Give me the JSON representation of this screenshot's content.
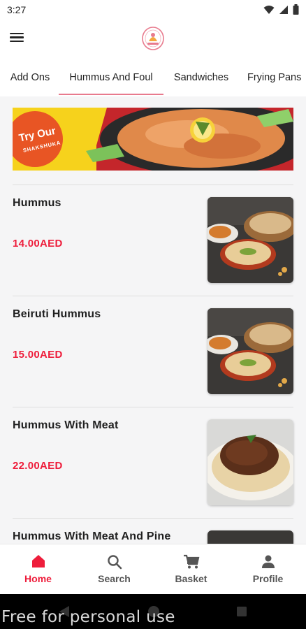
{
  "status_bar": {
    "time": "3:27"
  },
  "header": {
    "logo_icon": "restaurant-logo-icon",
    "menu_icon": "hamburger-menu-icon"
  },
  "tabs": [
    {
      "label": "Add Ons"
    },
    {
      "label": "Hummus And Foul",
      "active": true
    },
    {
      "label": "Sandwiches"
    },
    {
      "label": "Frying Pans"
    }
  ],
  "banner": {
    "headline": "Try Our",
    "subline": "SHAKSHUKA"
  },
  "items": [
    {
      "name": "Hummus",
      "price": "14.00AED",
      "image": "hummus-plate"
    },
    {
      "name": "Beiruti Hummus",
      "price": "15.00AED",
      "image": "hummus-plate"
    },
    {
      "name": "Hummus With Meat",
      "price": "22.00AED",
      "image": "hummus-meat"
    },
    {
      "name": "Hummus With Meat And Pine",
      "price": "",
      "image": "hummus-plate"
    }
  ],
  "bottom_nav": [
    {
      "label": "Home",
      "icon": "home-icon",
      "active": true
    },
    {
      "label": "Search",
      "icon": "search-icon"
    },
    {
      "label": "Basket",
      "icon": "cart-icon"
    },
    {
      "label": "Profile",
      "icon": "person-icon"
    }
  ],
  "watermark": "Free for personal use",
  "colors": {
    "accent": "#ee1d3b",
    "tab_underline": "#e87a8d"
  }
}
